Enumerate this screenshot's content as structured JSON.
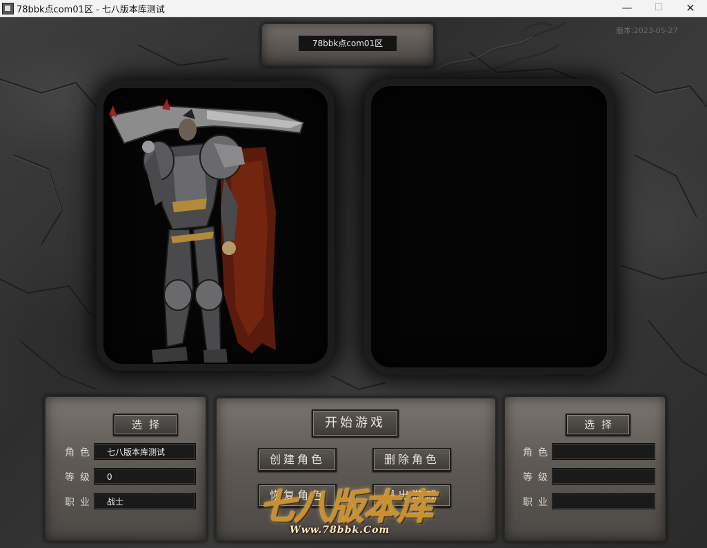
{
  "window": {
    "title": "78bbk点com01区 - 七八版本库测试",
    "minimize": "—",
    "maximize": "☐",
    "close": "✕"
  },
  "header": {
    "server_name": "78bbk点com01区",
    "version": "版本:2023-05-27"
  },
  "left_slot": {
    "select_label": "选择",
    "role_label": "角色",
    "level_label": "等级",
    "class_label": "职业",
    "role_value": "七八版本库测试",
    "level_value": "0",
    "class_value": "战士"
  },
  "right_slot": {
    "select_label": "选择",
    "role_label": "角色",
    "level_label": "等级",
    "class_label": "职业",
    "role_value": "",
    "level_value": "",
    "class_value": ""
  },
  "actions": {
    "start_game": "开始游戏",
    "create_role": "创建角色",
    "delete_role": "删除角色",
    "restore_role": "恢复角色",
    "exit_game": "退出游戏"
  },
  "logo": {
    "title": "七八版本库",
    "url": "Www.78bbk.Com"
  }
}
